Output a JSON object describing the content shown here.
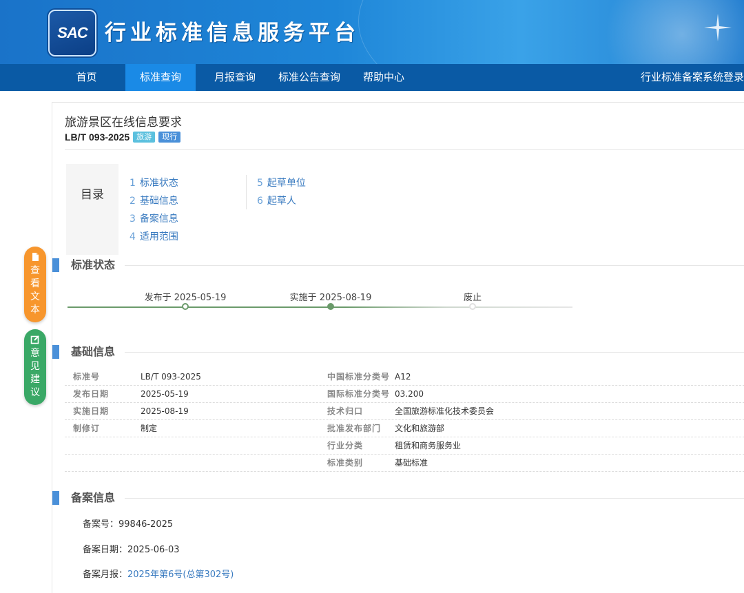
{
  "header": {
    "logo_text": "SAC",
    "site_title": "行业标准信息服务平台"
  },
  "nav": {
    "items": [
      "首页",
      "标准查询",
      "月报查询",
      "标准公告查询",
      "帮助中心"
    ],
    "right_link": "行业标准备案系统登录"
  },
  "doc": {
    "title": "旅游景区在线信息要求",
    "code": "LB/T 093-2025",
    "category_tag": "旅游",
    "status_tag": "现行"
  },
  "toc": {
    "label": "目录",
    "items": [
      {
        "num": "1",
        "text": "标准状态"
      },
      {
        "num": "2",
        "text": "基础信息"
      },
      {
        "num": "3",
        "text": "备案信息"
      },
      {
        "num": "4",
        "text": "适用范围"
      },
      {
        "num": "5",
        "text": "起草单位"
      },
      {
        "num": "6",
        "text": "起草人"
      }
    ]
  },
  "sections": {
    "status": "标准状态",
    "basic": "基础信息",
    "backup": "备案信息"
  },
  "timeline": {
    "published": "发布于 2025-05-19",
    "implemented": "实施于 2025-08-19",
    "abolished": "废止"
  },
  "basic_info": {
    "left": [
      {
        "key": "标准号",
        "value": "LB/T 093-2025"
      },
      {
        "key": "发布日期",
        "value": "2025-05-19"
      },
      {
        "key": "实施日期",
        "value": "2025-08-19"
      },
      {
        "key": "制修订",
        "value": "制定"
      }
    ],
    "right": [
      {
        "key": "中国标准分类号",
        "value": "A12"
      },
      {
        "key": "国际标准分类号",
        "value": "03.200"
      },
      {
        "key": "技术归口",
        "value": "全国旅游标准化技术委员会"
      },
      {
        "key": "批准发布部门",
        "value": "文化和旅游部"
      },
      {
        "key": "行业分类",
        "value": "租赁和商务服务业"
      },
      {
        "key": "标准类别",
        "value": "基础标准"
      }
    ]
  },
  "backup_info": {
    "number_label": "备案号：",
    "number": "99846-2025",
    "date_label": "备案日期：",
    "date": "2025-06-03",
    "monthly_label": "备案月报：",
    "monthly_link": "2025年第6号(总第302号)"
  },
  "float_buttons": {
    "view_text": "查看文本",
    "opinion": "意见建议"
  },
  "colors": {
    "banner": "#1e86d8",
    "nav": "#0a5aa5",
    "nav_active": "#1a8ae6",
    "accent": "#4a90d9",
    "link": "#3a7bc0",
    "view_text_btn": "#f7962d",
    "opinion_btn": "#3aa866"
  }
}
